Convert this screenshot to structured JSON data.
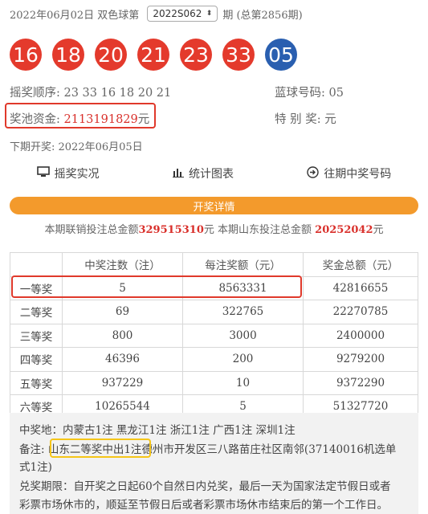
{
  "header": {
    "date_prefix": "2022年06月02日 双色球第",
    "issue_selected": "2022S062",
    "period_suffix": "期 (总第2856期)"
  },
  "balls": {
    "red": [
      "16",
      "18",
      "20",
      "21",
      "23",
      "33"
    ],
    "blue": "05",
    "red_color": "#e43a2c",
    "blue_color": "#2a5fb0"
  },
  "draw_order": "摇奖顺序: 23 33 16 18 20 21",
  "blue_number": "蓝球号码: 05",
  "pool_label": "奖池资金: ",
  "pool_amount": "2113191829",
  "pool_unit": "元",
  "special_prize": "特 别 奖: 元",
  "next_draw": "下期开奖: 2022年06月05日",
  "tabs": {
    "live": "摇奖实况",
    "charts": "统计图表",
    "history": "往期中奖号码"
  },
  "details_bar": "开奖详情",
  "sales": {
    "prefix": "本期联销投注总金额",
    "total": "329515310",
    "middle": "元 本期山东投注总金额",
    "shandong": "20252042",
    "suffix": "元"
  },
  "table": {
    "headers": [
      "",
      "中奖注数（注）",
      "每注奖额（元）",
      "奖金总额（元）"
    ],
    "rows": [
      [
        "一等奖",
        "5",
        "8563331",
        "42816655"
      ],
      [
        "二等奖",
        "69",
        "322765",
        "22270785"
      ],
      [
        "三等奖",
        "800",
        "3000",
        "2400000"
      ],
      [
        "四等奖",
        "46396",
        "200",
        "9279200"
      ],
      [
        "五等奖",
        "937229",
        "10",
        "9372290"
      ],
      [
        "六等奖",
        "10265544",
        "5",
        "51327720"
      ]
    ]
  },
  "info": {
    "winners": "中奖地：内蒙古1注 黑龙江1注 浙江1注 广西1注 深圳1注",
    "note_label": "备注: ",
    "note_highlight": "山东二等奖中出1注",
    "note_rest": "德州市开发区三八路苗庄社区南邻(37140016机选单",
    "note_rest2": "式1注)",
    "claim_line1": "兑奖期限：自开奖之日起60个自然日内兑奖，最后一天为国家法定节假日或者",
    "claim_line2": "彩票市场休市的，顺延至节假日后或者彩票市场休市结束后的第一个工作日。"
  }
}
